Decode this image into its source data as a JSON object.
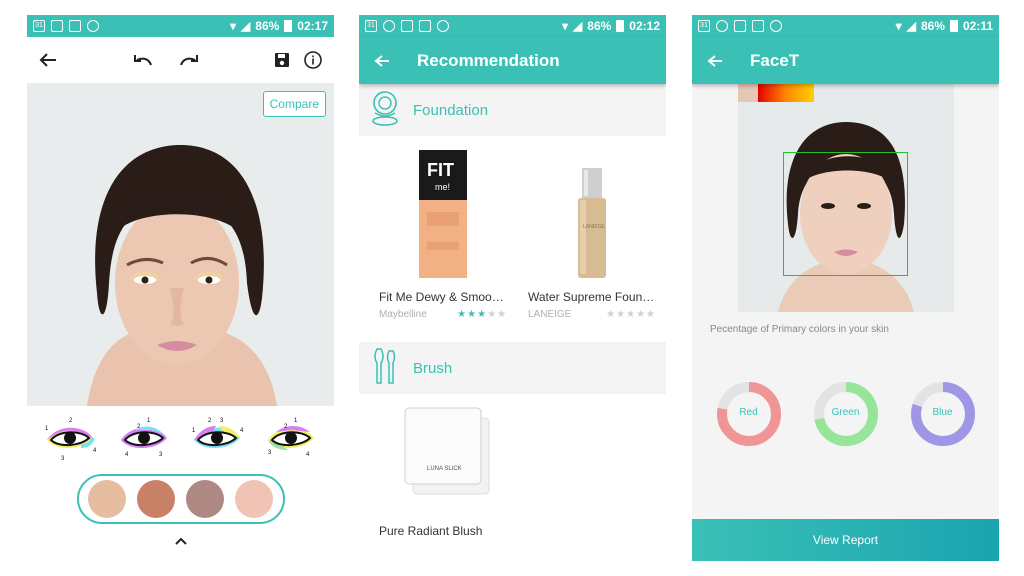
{
  "status1": {
    "battery": "86%",
    "time": "02:17"
  },
  "status2": {
    "battery": "86%",
    "time": "02:12"
  },
  "status3": {
    "battery": "86%",
    "time": "02:11"
  },
  "editor": {
    "compare_label": "Compare",
    "swatches": [
      "#e6bda1",
      "#c88066",
      "#ae8882",
      "#f1c3b4"
    ]
  },
  "recommendation": {
    "title": "Recommendation",
    "sections": {
      "foundation": "Foundation",
      "brush": "Brush"
    },
    "products": [
      {
        "name": "Fit Me Dewy & Smooth...",
        "brand": "Maybelline",
        "rating": 3
      },
      {
        "name": "Water Supreme Found...",
        "brand": "LANEIGE",
        "rating": 0
      }
    ],
    "blush": {
      "name": "Pure Radiant Blush"
    }
  },
  "facet": {
    "title": "FaceT",
    "subtitle": "Pecentage of Primary colors in your skin",
    "donuts": [
      {
        "label": "Red",
        "color": "#f09595",
        "fraction": 0.78
      },
      {
        "label": "Green",
        "color": "#96e59a",
        "fraction": 0.72
      },
      {
        "label": "Blue",
        "color": "#9f97e5",
        "fraction": 0.8
      }
    ],
    "button": "View Report"
  }
}
